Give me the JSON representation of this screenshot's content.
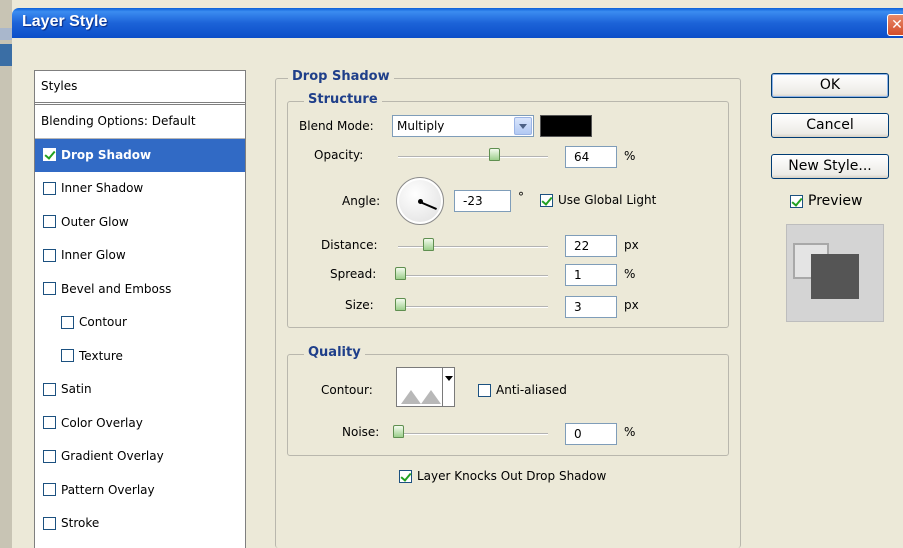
{
  "window": {
    "title": "Layer Style",
    "close_glyph": "✕"
  },
  "styles_panel": {
    "header": "Styles",
    "blending_options": "Blending Options: Default",
    "items": [
      {
        "label": "Drop Shadow",
        "checked": true,
        "selected": true,
        "sub": false
      },
      {
        "label": "Inner Shadow",
        "checked": false,
        "selected": false,
        "sub": false
      },
      {
        "label": "Outer Glow",
        "checked": false,
        "selected": false,
        "sub": false
      },
      {
        "label": "Inner Glow",
        "checked": false,
        "selected": false,
        "sub": false
      },
      {
        "label": "Bevel and Emboss",
        "checked": false,
        "selected": false,
        "sub": false
      },
      {
        "label": "Contour",
        "checked": false,
        "selected": false,
        "sub": true
      },
      {
        "label": "Texture",
        "checked": false,
        "selected": false,
        "sub": true
      },
      {
        "label": "Satin",
        "checked": false,
        "selected": false,
        "sub": false
      },
      {
        "label": "Color Overlay",
        "checked": false,
        "selected": false,
        "sub": false
      },
      {
        "label": "Gradient Overlay",
        "checked": false,
        "selected": false,
        "sub": false
      },
      {
        "label": "Pattern Overlay",
        "checked": false,
        "selected": false,
        "sub": false
      },
      {
        "label": "Stroke",
        "checked": false,
        "selected": false,
        "sub": false
      }
    ]
  },
  "drop_shadow": {
    "section_title": "Drop Shadow",
    "structure": {
      "title": "Structure",
      "blend_mode": {
        "label": "Blend Mode:",
        "value": "Multiply",
        "color": "#000000"
      },
      "opacity": {
        "label": "Opacity:",
        "value": "64",
        "unit": "%",
        "level": 0.64
      },
      "angle": {
        "label": "Angle:",
        "value": "-23",
        "unit": "°",
        "use_global_light": {
          "label": "Use Global Light",
          "checked": true
        }
      },
      "distance": {
        "label": "Distance:",
        "value": "22",
        "unit": "px",
        "level": 0.2
      },
      "spread": {
        "label": "Spread:",
        "value": "1",
        "unit": "%",
        "level": 0.01
      },
      "size": {
        "label": "Size:",
        "value": "3",
        "unit": "px",
        "level": 0.01
      }
    },
    "quality": {
      "title": "Quality",
      "contour": {
        "label": "Contour:"
      },
      "anti_aliased": {
        "label": "Anti-aliased",
        "checked": false
      },
      "noise": {
        "label": "Noise:",
        "value": "0",
        "unit": "%",
        "level": 0.0
      }
    },
    "knocks_out": {
      "label": "Layer Knocks Out Drop Shadow",
      "checked": true
    }
  },
  "buttons": {
    "ok": "OK",
    "cancel": "Cancel",
    "new_style": "New Style..."
  },
  "preview": {
    "label": "Preview",
    "checked": true
  }
}
